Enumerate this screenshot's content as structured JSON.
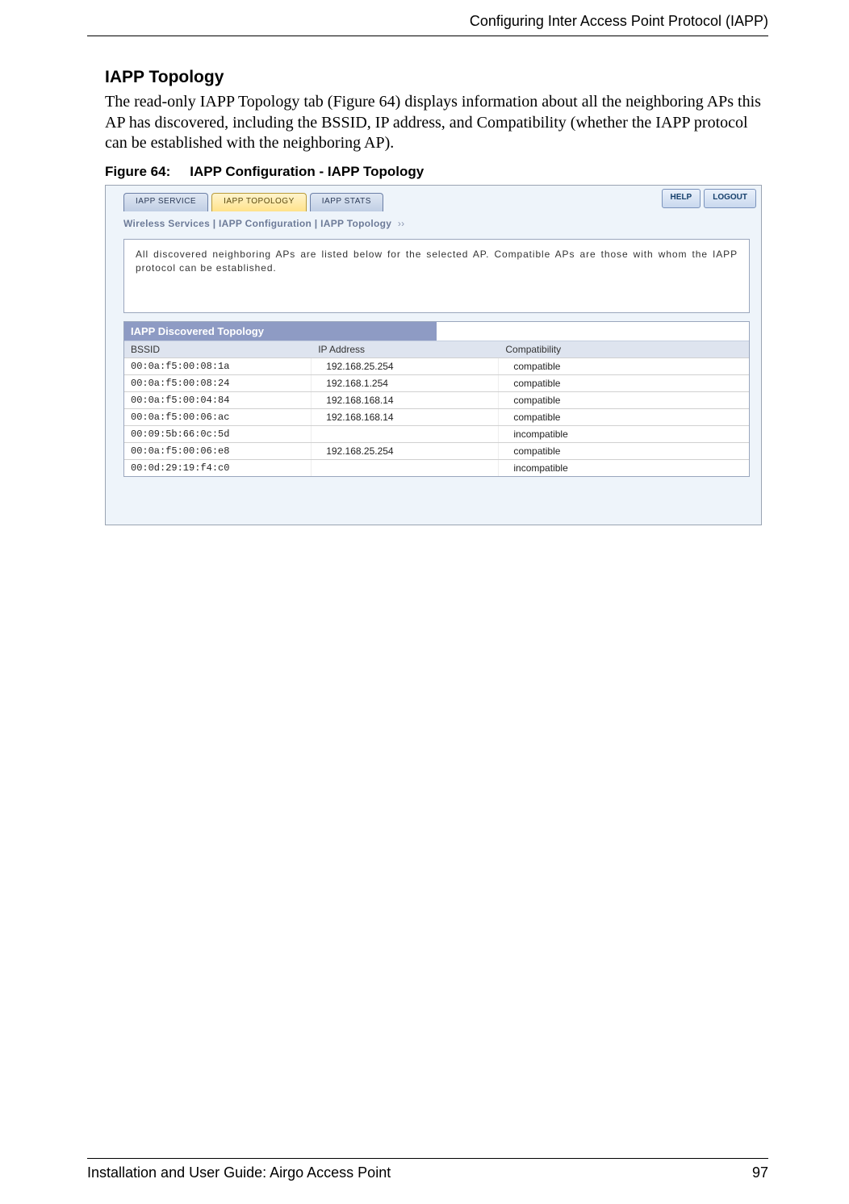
{
  "header": {
    "chapter": "Configuring Inter Access Point Protocol (IAPP)"
  },
  "section": {
    "title": "IAPP Topology",
    "body": "The read-only IAPP Topology tab (Figure 64) displays information about all the neighboring APs this AP has discovered, including the BSSID, IP address, and Compatibility (whether the IAPP protocol can be established with the neighboring AP).",
    "figure_label_prefix": "Figure 64:",
    "figure_label_text": "IAPP Configuration - IAPP Topology"
  },
  "screenshot": {
    "tabs": [
      {
        "label": "IAPP SERVICE",
        "active": false
      },
      {
        "label": "IAPP TOPOLOGY",
        "active": true
      },
      {
        "label": "IAPP STATS",
        "active": false
      }
    ],
    "buttons": {
      "help": "HELP",
      "logout": "LOGOUT"
    },
    "breadcrumb": "Wireless Services | IAPP Configuration | IAPP Topology",
    "infobox": "All discovered neighboring APs are listed below for the selected AP. Compatible APs are those with whom the IAPP protocol can be established.",
    "table": {
      "title": "IAPP Discovered Topology",
      "headers": {
        "bssid": "BSSID",
        "ip": "IP Address",
        "compat": "Compatibility"
      },
      "rows": [
        {
          "bssid": "00:0a:f5:00:08:1a",
          "ip": "192.168.25.254",
          "compat": "compatible"
        },
        {
          "bssid": "00:0a:f5:00:08:24",
          "ip": "192.168.1.254",
          "compat": "compatible"
        },
        {
          "bssid": "00:0a:f5:00:04:84",
          "ip": "192.168.168.14",
          "compat": "compatible"
        },
        {
          "bssid": "00:0a:f5:00:06:ac",
          "ip": "192.168.168.14",
          "compat": "compatible"
        },
        {
          "bssid": "00:09:5b:66:0c:5d",
          "ip": "",
          "compat": "incompatible"
        },
        {
          "bssid": "00:0a:f5:00:06:e8",
          "ip": "192.168.25.254",
          "compat": "compatible"
        },
        {
          "bssid": "00:0d:29:19:f4:c0",
          "ip": "",
          "compat": "incompatible"
        }
      ]
    }
  },
  "footer": {
    "left": "Installation and User Guide: Airgo Access Point",
    "right": "97"
  }
}
